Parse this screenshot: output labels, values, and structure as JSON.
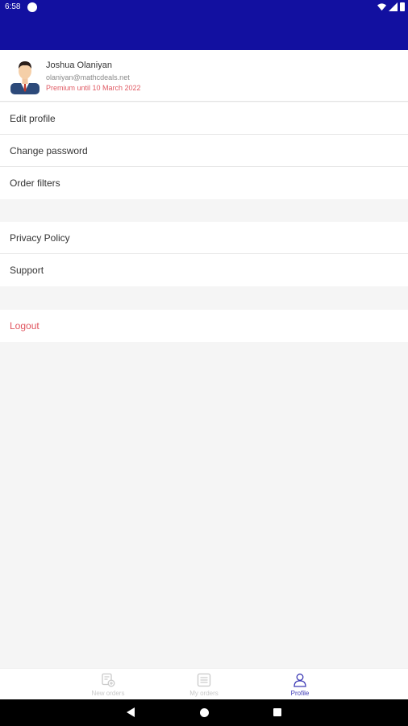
{
  "status_bar": {
    "time": "6:58"
  },
  "profile": {
    "name": "Joshua Olaniyan",
    "email": "olaniyan@mathcdeals.net",
    "premium": "Premium until 10 March 2022"
  },
  "menu": {
    "account": [
      "Edit profile",
      "Change password",
      "Order filters"
    ],
    "info": [
      "Privacy Policy",
      "Support"
    ],
    "logout": "Logout"
  },
  "bottom_nav": {
    "items": [
      {
        "label": "New orders",
        "icon": "new-orders-icon",
        "active": false
      },
      {
        "label": "My orders",
        "icon": "list-icon",
        "active": false
      },
      {
        "label": "Profile",
        "icon": "person-icon",
        "active": true
      }
    ]
  },
  "colors": {
    "primary": "#1210a0",
    "accent": "#e05a64",
    "nav_active": "#3d3ab5"
  }
}
